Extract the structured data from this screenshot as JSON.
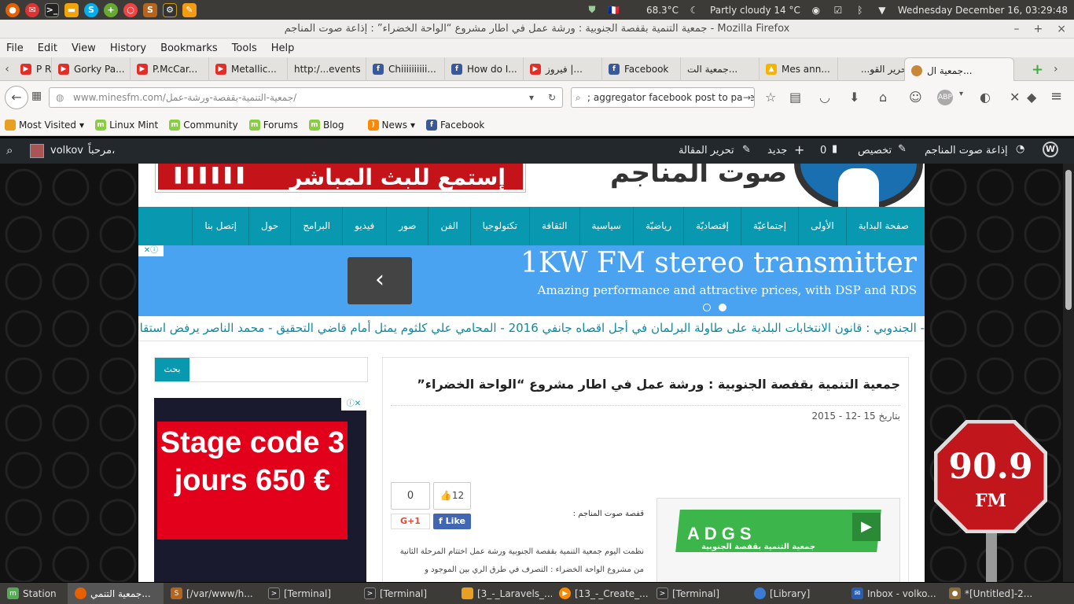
{
  "system": {
    "temperature": "68.3°C",
    "weather": "Partly cloudy 14 °C",
    "datetime": "Wednesday December 16, 03:29:48",
    "flag": "🇫🇷"
  },
  "window": {
    "title": "جمعية التنمية بقفصة الجنوبية : ورشة عمل في اطار مشروع “الواحة الخضراء” : إذاعة صوت المناجم - Mozilla Firefox"
  },
  "menu": [
    "File",
    "Edit",
    "View",
    "History",
    "Bookmarks",
    "Tools",
    "Help"
  ],
  "tabs": [
    {
      "label": "P Re...",
      "icon": "youtube-icon"
    },
    {
      "label": "Gorky Pa...",
      "icon": "youtube-icon"
    },
    {
      "label": "P.McCar...",
      "icon": "youtube-icon"
    },
    {
      "label": "Metallic...",
      "icon": "youtube-icon"
    },
    {
      "label": "http:/...events",
      "icon": "none"
    },
    {
      "label": "Chiiiiiiiiii...",
      "icon": "facebook-icon"
    },
    {
      "label": "How do I...",
      "icon": "facebook-icon"
    },
    {
      "label": "فيروز |...",
      "icon": "youtube-icon"
    },
    {
      "label": "Facebook",
      "icon": "facebook-icon"
    },
    {
      "label": "جمعية الت...",
      "icon": "none"
    },
    {
      "label": "Mes ann...",
      "icon": "drive-icon"
    },
    {
      "label": "تحرير القو...",
      "icon": "none"
    }
  ],
  "active_tab": "جمعية ال...",
  "nav": {
    "url_host": "www.minesfm.com",
    "url_path": "/جمعية-التنمية-بقفصة-ورشة-عمل/",
    "search_text": "; aggregator facebook post to page"
  },
  "bookmarks": [
    "Most Visited",
    "Linux Mint",
    "Community",
    "Forums",
    "Blog",
    "News",
    "Facebook"
  ],
  "wp": {
    "greeting": "مرحباً،",
    "user": "volkov",
    "site": "إذاعة صوت المناجم",
    "customize": "تخصيص",
    "comments": "0",
    "new": "جديد",
    "edit": "تحرير المقالة"
  },
  "site": {
    "logo_text": "صوت المناجم",
    "live_banner": "إستمع للبث المباشر",
    "menu": [
      "صفحة البداية",
      "الأولى",
      "إجتماعيّة",
      "إقتصاديّة",
      "رياضيّة",
      "سياسية",
      "الثقافة",
      "تكنولوجيا",
      "الفن",
      "صور",
      "فيديو",
      "البرامج",
      "حول",
      "إتصل بنا"
    ],
    "ad": {
      "title": "1KW FM stereo transmitter",
      "subtitle": "Amazing performance and attractive prices, with DSP and RDS"
    },
    "ticker": "- الجندوبي : قانون الانتخابات البلدية على طاولة البرلمان في أجل اقصاه جانفي 2016 - المحامي علي كلثوم يمثل أمام قاضي التحقيق - محمد الناصر يرفض استقالة",
    "search_button": "بحث",
    "side_ad": "Stage code 3 jours 650 €",
    "article": {
      "title": "جمعية التنمية بقفصة الجنوبية : ورشة عمل في اطار مشروع “الواحة الخضراء”",
      "date": "بتاريخ 15 -12 - 2015",
      "byline": "قفصة صوت المناجم :",
      "body": "نظمت اليوم جمعية التنمية بقفصة الجنوبية ورشة عمل اختتام المرحلة الثانية من مشروع الواحة الخضراء : التصرف في طرق الري بين الموجود و",
      "gplus_count": "0",
      "gplus_label": "G+1",
      "fb_count": "12",
      "fb_label": "Like",
      "image_label": "ADGS",
      "image_caption": "جمعية التنمية بقفصة الجنوبية"
    },
    "radio_badge": "90.9",
    "radio_fm": "FM"
  },
  "taskbar": [
    {
      "label": "Station",
      "icon": "mint-icon"
    },
    {
      "label": "جمعية التنمي...",
      "icon": "firefox-icon"
    },
    {
      "label": "[/var/www/h...",
      "icon": "sublime-icon"
    },
    {
      "label": "[Terminal]",
      "icon": "terminal-icon"
    },
    {
      "label": "[Terminal]",
      "icon": "terminal-icon"
    },
    {
      "label": "[3_-_Laravels_...",
      "icon": "folder-icon"
    },
    {
      "label": "[13_-_Create_...",
      "icon": "vlc-icon"
    },
    {
      "label": "[Terminal]",
      "icon": "terminal-icon"
    },
    {
      "label": "[Library]",
      "icon": "firefox-icon"
    },
    {
      "label": "Inbox - volko...",
      "icon": "thunderbird-icon"
    },
    {
      "label": "*[Untitled]-2...",
      "icon": "gimp-icon"
    }
  ]
}
